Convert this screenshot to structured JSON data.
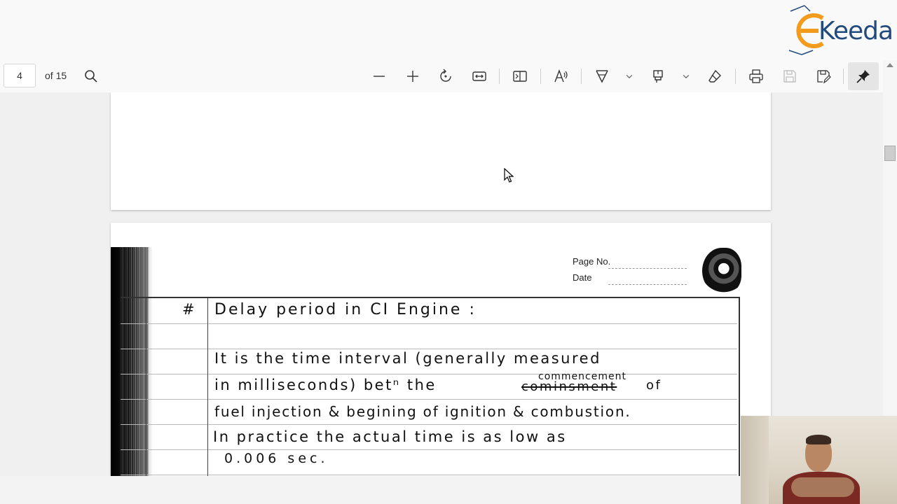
{
  "brand": {
    "logo_text": "Keeda"
  },
  "toolbar": {
    "page_number": "4",
    "page_of": "of 15",
    "icons": [
      "search-icon",
      "zoom-out-icon",
      "zoom-in-icon",
      "rotate-icon",
      "fit-width-icon",
      "page-view-icon",
      "read-aloud-icon",
      "draw-icon",
      "chevron-down-icon",
      "highlight-icon",
      "chevron-down-icon",
      "eraser-icon",
      "print-icon",
      "save-icon",
      "save-as-icon",
      "pin-icon"
    ]
  },
  "notebook": {
    "page_no_label": "Page No.",
    "date_label": "Date",
    "hash": "#",
    "heading": "Delay period in CI Engine :",
    "lines": [
      "It is the time interval (generally measured",
      "in milliseconds) betⁿ the",
      "fuel injection & begining of ignition & combustion.",
      "In practice the actual time is as low as",
      "0.006 sec."
    ],
    "struck_word": "cominsment",
    "inserted_word": "commencement",
    "after_struck": "of"
  },
  "colors": {
    "logo_blue": "#234a7d",
    "logo_orange": "#f29b1d",
    "toolbar_bg": "#f9f9f9"
  }
}
